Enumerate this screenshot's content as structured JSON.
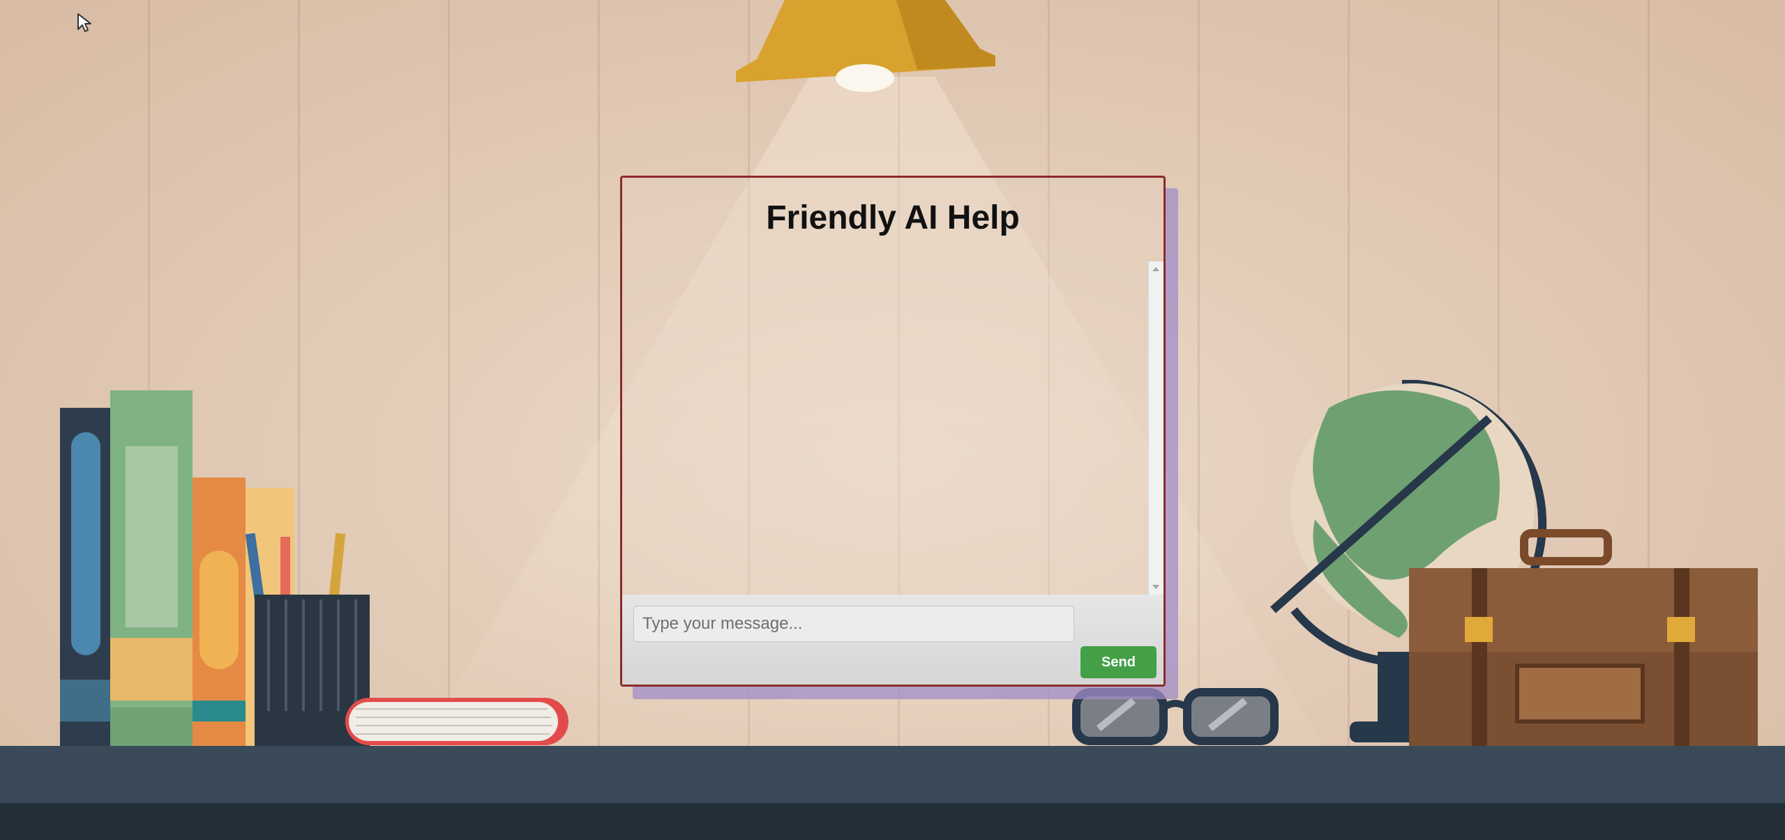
{
  "chat": {
    "title": "Friendly AI Help",
    "input_placeholder": "Type your message...",
    "send_label": "Send",
    "messages": []
  },
  "colors": {
    "window_border": "#8a2b2b",
    "send_button": "#43a047",
    "window_shadow": "#a08cc8"
  },
  "icons": {
    "cursor": "mouse-pointer-icon",
    "scroll_up": "scroll-up-arrow-icon",
    "scroll_down": "scroll-down-arrow-icon"
  }
}
